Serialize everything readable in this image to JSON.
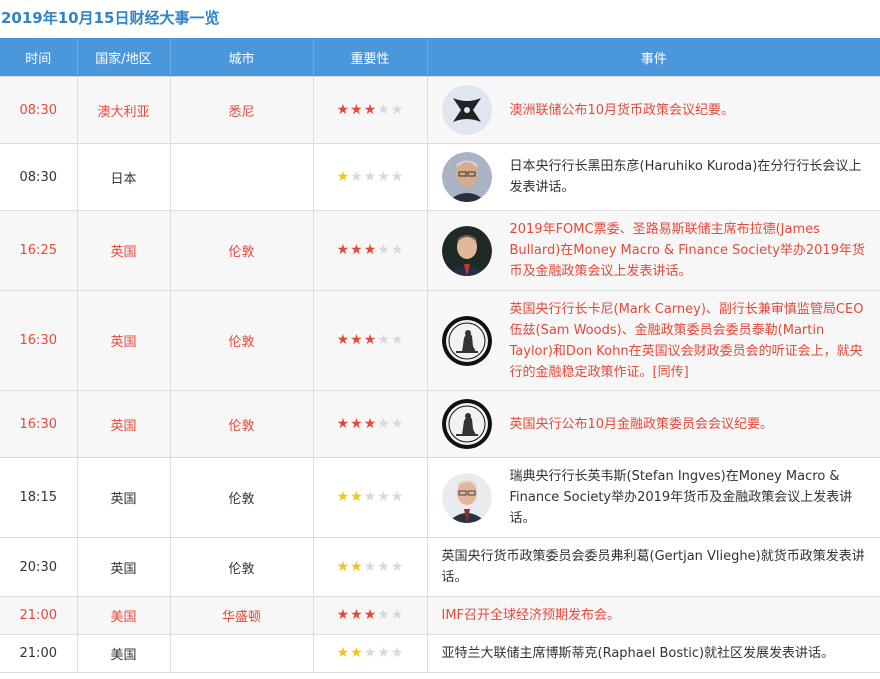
{
  "page_title": "2019年10月15日财经大事一览",
  "headers": {
    "time": "时间",
    "country": "国家/地区",
    "city": "城市",
    "importance": "重要性",
    "event": "事件"
  },
  "colors": {
    "accent": "#4b97dc",
    "highlight": "#e24a3b",
    "star_yellow": "#f3c31d",
    "star_gray": "#d6d9e2"
  },
  "rows": [
    {
      "time": "08:30",
      "country": "澳大利亚",
      "city": "悉尼",
      "stars": 3,
      "highlight": true,
      "avatar": "rba-logo-icon",
      "event": "澳洲联储公布10月货币政策会议纪要。"
    },
    {
      "time": "08:30",
      "country": "日本",
      "city": "",
      "stars": 1,
      "highlight": false,
      "avatar": "kuroda-photo",
      "event": "日本央行行长黑田东彦(Haruhiko Kuroda)在分行行长会议上发表讲话。"
    },
    {
      "time": "16:25",
      "country": "英国",
      "city": "伦敦",
      "stars": 3,
      "highlight": true,
      "avatar": "bullard-photo",
      "event": "2019年FOMC票委、圣路易斯联储主席布拉德(James Bullard)在Money Macro & Finance Society举办2019年货币及金融政策会议上发表讲话。"
    },
    {
      "time": "16:30",
      "country": "英国",
      "city": "伦敦",
      "stars": 3,
      "highlight": true,
      "avatar": "boe-logo-icon",
      "event": "英国央行行长卡尼(Mark Carney)、副行长兼审慎监管局CEO伍兹(Sam Woods)、金融政策委员会委员泰勒(Martin Taylor)和Don Kohn在英国议会财政委员会的听证会上，就央行的金融稳定政策作证。[同传]"
    },
    {
      "time": "16:30",
      "country": "英国",
      "city": "伦敦",
      "stars": 3,
      "highlight": true,
      "avatar": "boe-logo-icon",
      "event": "英国央行公布10月金融政策委员会会议纪要。"
    },
    {
      "time": "18:15",
      "country": "英国",
      "city": "伦敦",
      "stars": 2,
      "highlight": false,
      "avatar": "ingves-photo",
      "event": "瑞典央行行长英韦斯(Stefan Ingves)在Money Macro & Finance Society举办2019年货币及金融政策会议上发表讲话。"
    },
    {
      "time": "20:30",
      "country": "英国",
      "city": "伦敦",
      "stars": 2,
      "highlight": false,
      "avatar": "",
      "event": "英国央行货币政策委员会委员弗利葛(Gertjan Vlieghe)就货币政策发表讲话。"
    },
    {
      "time": "21:00",
      "country": "美国",
      "city": "华盛顿",
      "stars": 3,
      "highlight": true,
      "avatar": "",
      "event": "IMF召开全球经济预期发布会。"
    },
    {
      "time": "21:00",
      "country": "美国",
      "city": "",
      "stars": 2,
      "highlight": false,
      "avatar": "",
      "event": "亚特兰大联储主席博斯蒂克(Raphael Bostic)就社区发展发表讲话。"
    }
  ]
}
